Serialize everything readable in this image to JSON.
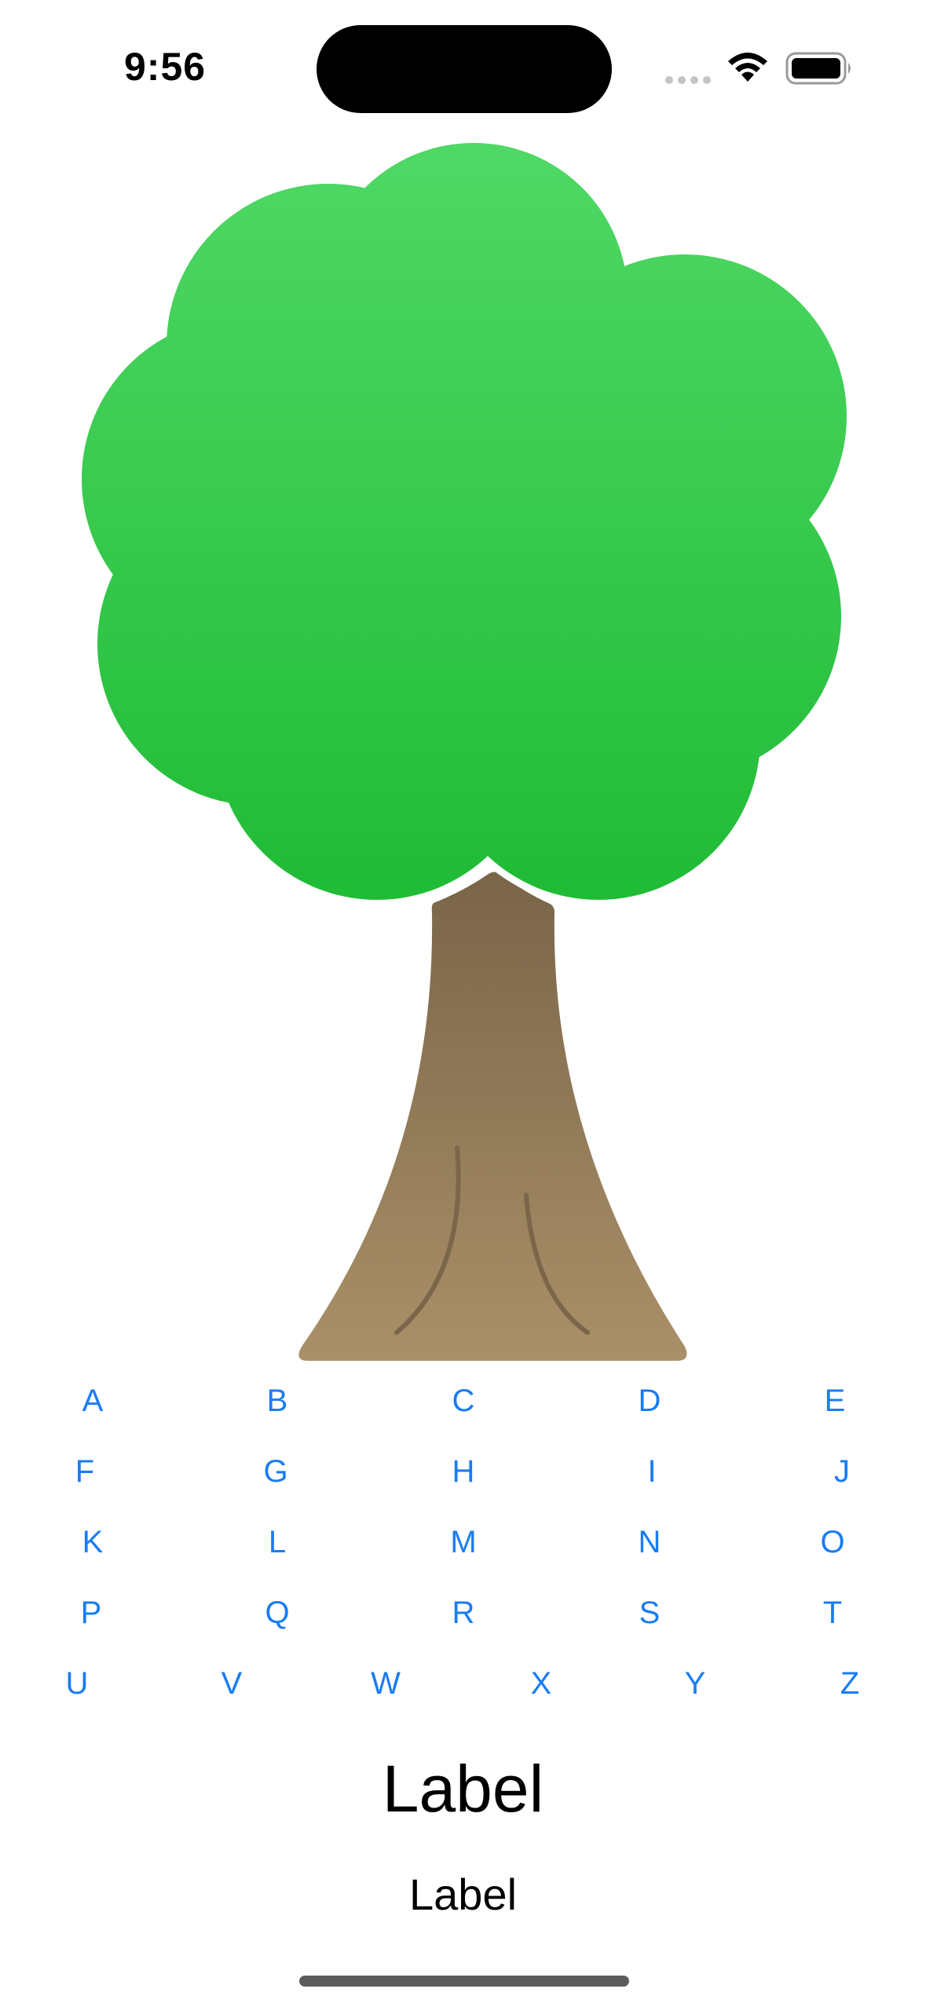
{
  "status_bar": {
    "time": "9:56"
  },
  "tree": {
    "icon": "tree-illustration",
    "canopy_color_top": "#4fd865",
    "canopy_color_bottom": "#1fbb35",
    "trunk_color_top": "#7a6549",
    "trunk_color_bottom": "#aa9068"
  },
  "letters": {
    "row1": [
      "A",
      "B",
      "C",
      "D",
      "E"
    ],
    "row2": [
      "F",
      "G",
      "H",
      "I",
      "J"
    ],
    "row3": [
      "K",
      "L",
      "M",
      "N",
      "O"
    ],
    "row4": [
      "P",
      "Q",
      "R",
      "S",
      "T"
    ],
    "row5": [
      "U",
      "V",
      "W",
      "X",
      "Y",
      "Z"
    ]
  },
  "labels": {
    "primary": "Label",
    "secondary": "Label"
  },
  "colors": {
    "accent": "#1a7cf3"
  }
}
